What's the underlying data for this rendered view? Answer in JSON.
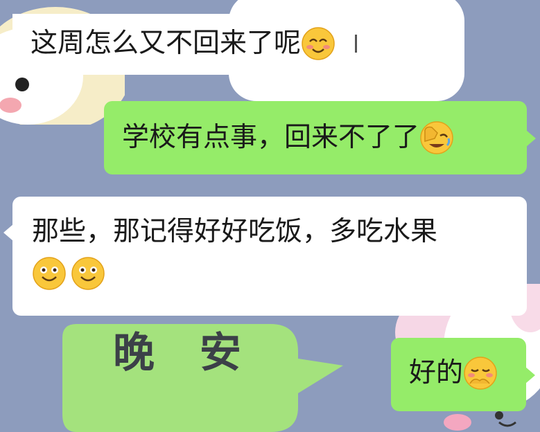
{
  "background": {
    "color": "#8d9cbd",
    "sticker_text": "晚 安"
  },
  "messages": [
    {
      "id": "m1",
      "side": "in",
      "text": "这周怎么又不回来了呢",
      "emojis": [
        "smiling-blush-emoji"
      ]
    },
    {
      "id": "m2",
      "side": "out",
      "text": "学校有点事，回来不了了",
      "emojis": [
        "facepalm-laughing-emoji"
      ]
    },
    {
      "id": "m3",
      "side": "in",
      "text": "那些，那记得好好吃饭，多吃水果",
      "emojis": [
        "smile-emoji",
        "smile-emoji"
      ]
    },
    {
      "id": "m4",
      "side": "out",
      "text": "好的",
      "emojis": [
        "shy-cover-mouth-emoji"
      ]
    }
  ],
  "colors": {
    "incoming_bubble": "#ffffff",
    "outgoing_bubble": "#95ec69"
  }
}
